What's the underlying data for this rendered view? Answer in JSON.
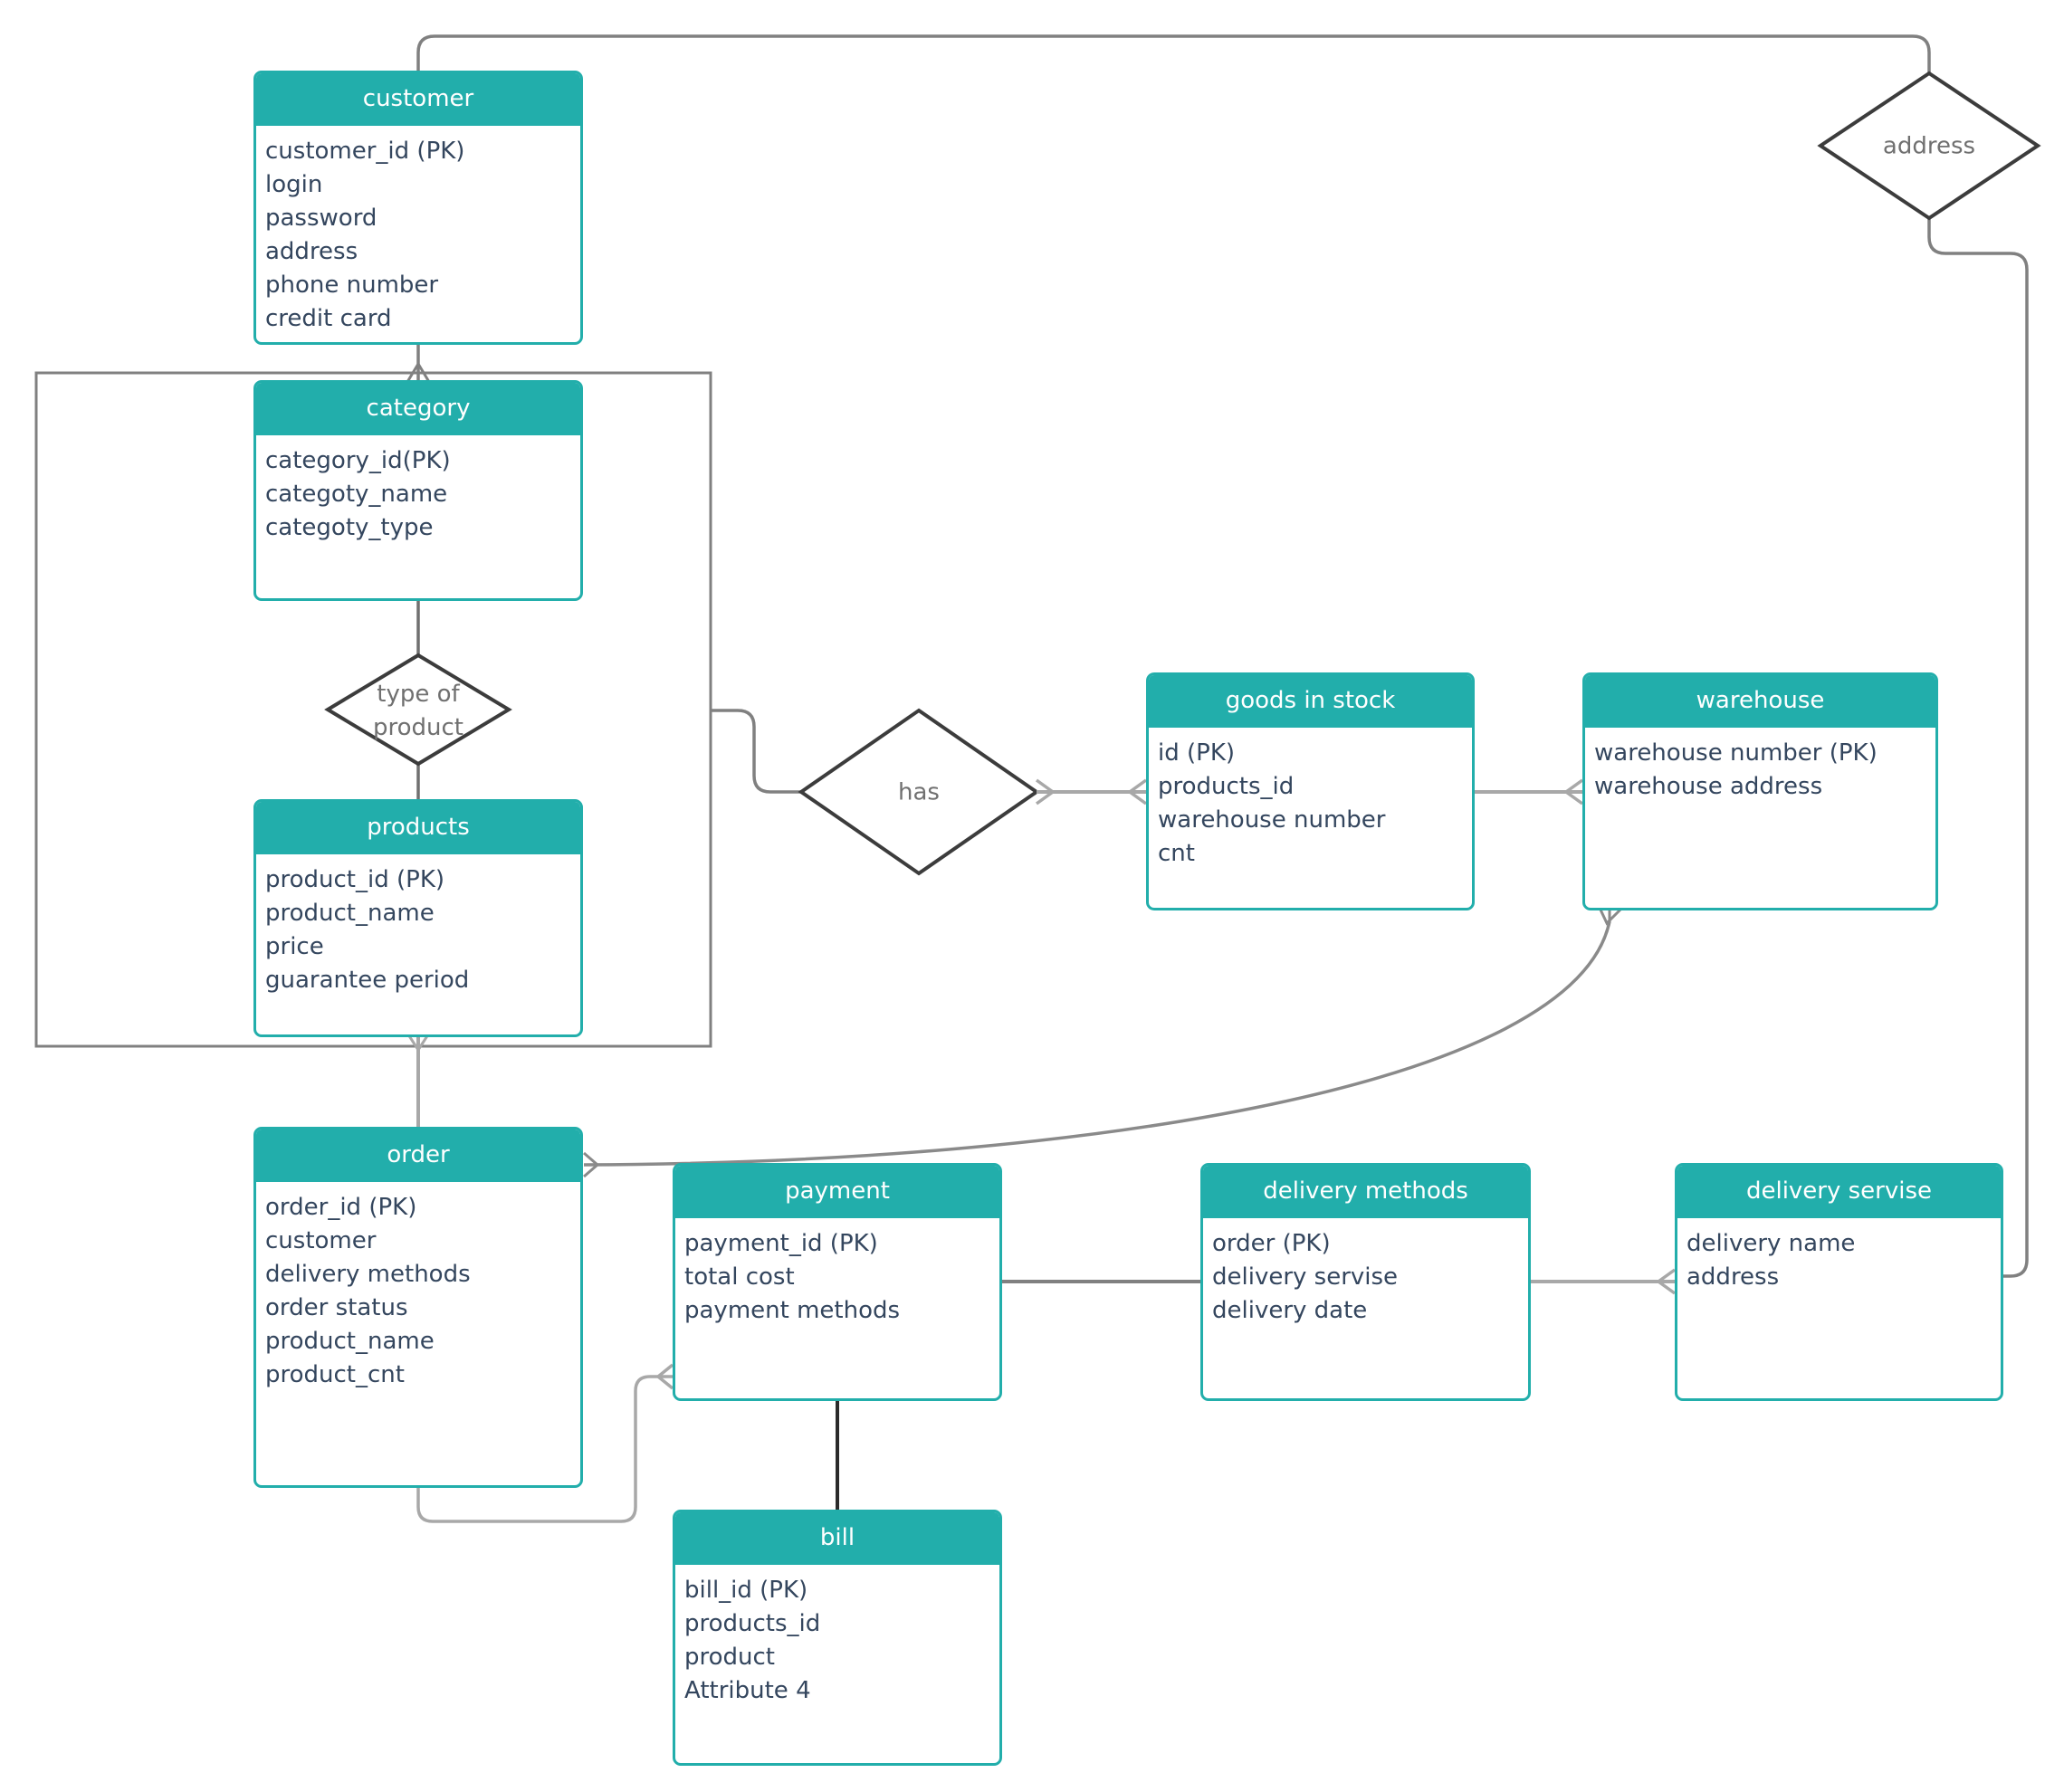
{
  "entities": {
    "customer": {
      "title": "customer",
      "attributes": [
        "customer_id (PK)",
        "login",
        "password",
        "address",
        "phone number",
        "credit card"
      ]
    },
    "category": {
      "title": "category",
      "attributes": [
        "category_id(PK)",
        "categoty_name",
        "categoty_type"
      ]
    },
    "products": {
      "title": "products",
      "attributes": [
        "product_id (PK)",
        "product_name",
        "price",
        "guarantee period"
      ]
    },
    "goods_in_stock": {
      "title": "goods in stock",
      "attributes": [
        "id (PK)",
        "products_id",
        "warehouse number",
        "cnt"
      ]
    },
    "warehouse": {
      "title": "warehouse",
      "attributes": [
        "warehouse number (PK)",
        "warehouse address"
      ]
    },
    "order": {
      "title": "order",
      "attributes": [
        "order_id (PK)",
        "customer",
        "delivery methods",
        "order status",
        "product_name",
        "product_cnt"
      ]
    },
    "payment": {
      "title": "payment",
      "attributes": [
        "payment_id (PK)",
        "total cost",
        "payment methods"
      ]
    },
    "delivery_methods": {
      "title": "delivery methods",
      "attributes": [
        "order (PK)",
        "delivery servise",
        "delivery date"
      ]
    },
    "delivery_servise": {
      "title": "delivery servise",
      "attributes": [
        "delivery name",
        "address"
      ]
    },
    "bill": {
      "title": "bill",
      "attributes": [
        "bill_id (PK)",
        "products_id",
        "product",
        "Attribute 4"
      ]
    }
  },
  "relationships": {
    "type_of_product": {
      "label": "type of\nproduct"
    },
    "has": {
      "label": "has"
    },
    "address": {
      "label": "address"
    }
  },
  "colors": {
    "entity_header": "#22aeab",
    "attribute_text": "#34465e",
    "relationship_text": "#707070",
    "connector_dark": "#808080",
    "connector_light": "#a8a8a8",
    "diamond_stroke": "#3c3c3c"
  }
}
